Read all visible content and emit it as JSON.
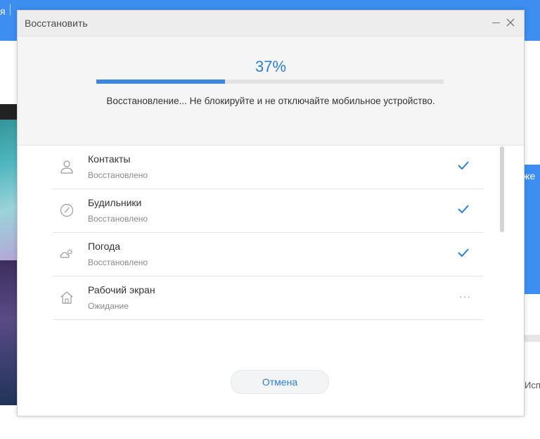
{
  "background": {
    "topbar_text": "я",
    "right_panel_text": "же",
    "right_label": "Исп"
  },
  "dialog": {
    "title": "Восстановить",
    "progress": {
      "percent_label": "37%",
      "value": 0.37,
      "status_text": "Восстановление... Не блокируйте и не отключайте мобильное устройство."
    },
    "items": [
      {
        "name": "Контакты",
        "status": "Восстановлено",
        "icon": "contact-icon",
        "state": "done"
      },
      {
        "name": "Будильники",
        "status": "Восстановлено",
        "icon": "alarm-icon",
        "state": "done"
      },
      {
        "name": "Погода",
        "status": "Восстановлено",
        "icon": "weather-icon",
        "state": "done"
      },
      {
        "name": "Рабочий экран",
        "status": "Ожидание",
        "icon": "home-icon",
        "state": "pending"
      }
    ],
    "pending_indicator": "···",
    "cancel_label": "Отмена"
  },
  "colors": {
    "accent": "#2d7fd6",
    "progress_fill": "#3e86e4",
    "app_blue": "#3d8ef0"
  }
}
